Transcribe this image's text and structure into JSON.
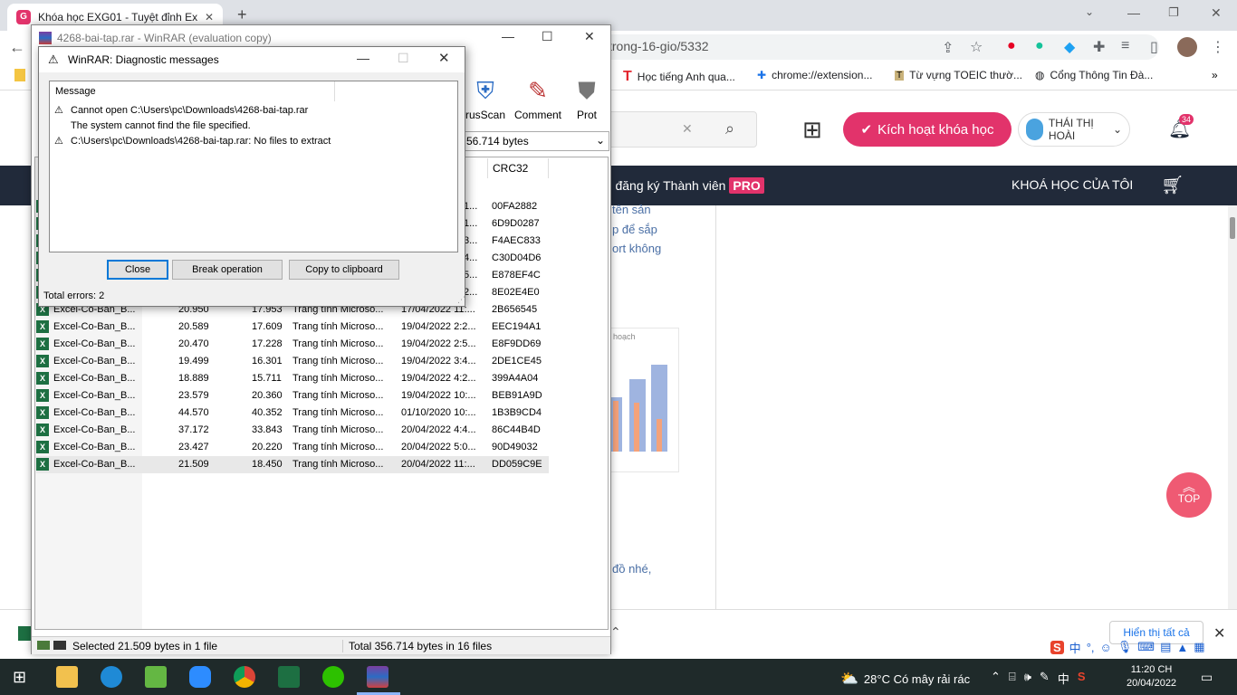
{
  "browser": {
    "tab_title": "Khóa học EXG01 - Tuyệt đỉnh Exc",
    "url_tail": "trong-16-gio/5332",
    "bookmarks": [
      "Học tiếng Anh qua...",
      "chrome://extension...",
      "Từ vựng TOEIC thườ...",
      "Cổng Thông Tin Đà..."
    ]
  },
  "site": {
    "activate_label": "Kích hoạt khóa học",
    "user_name": "THÁI THỊ HOÀI",
    "notif_count": "34",
    "nav_register": "ng đăng ký Thành viên",
    "nav_pro": "PRO",
    "nav_my_courses": "KHOÁ HỌC CỦA TÔI",
    "article_lines": [
      "tên sản",
      "p để sắp",
      "ort không"
    ],
    "article_bottom": "đồ nhé,",
    "chart_title": "hoạch",
    "top_label": "TOP",
    "show_all": "Hiển thị tất cả"
  },
  "winrar": {
    "title": "4268-bai-tap.rar - WinRAR (evaluation copy)",
    "tools": [
      "rusScan",
      "Comment",
      "Prot"
    ],
    "address_value": "56.714 bytes",
    "crc_header": "CRC32",
    "top_crcs": [
      "00FA2882",
      "6D9D0287",
      "F4AEC833",
      "C30D04D6",
      "E878EF4C",
      "8E02E4E0"
    ],
    "top_partial": [
      "1...",
      "1...",
      "3...",
      "4...",
      "5...",
      "2..."
    ],
    "rows": [
      {
        "name": "Excel-Co-Ban_B...",
        "size": "20.950",
        "packed": "17.953",
        "type": "Trang tính Microso...",
        "modified": "17/04/2022 11:...",
        "crc": "2B656545"
      },
      {
        "name": "Excel-Co-Ban_B...",
        "size": "20.589",
        "packed": "17.609",
        "type": "Trang tính Microso...",
        "modified": "19/04/2022 2:2...",
        "crc": "EEC194A1"
      },
      {
        "name": "Excel-Co-Ban_B...",
        "size": "20.470",
        "packed": "17.228",
        "type": "Trang tính Microso...",
        "modified": "19/04/2022 2:5...",
        "crc": "E8F9DD69"
      },
      {
        "name": "Excel-Co-Ban_B...",
        "size": "19.499",
        "packed": "16.301",
        "type": "Trang tính Microso...",
        "modified": "19/04/2022 3:4...",
        "crc": "2DE1CE45"
      },
      {
        "name": "Excel-Co-Ban_B...",
        "size": "18.889",
        "packed": "15.711",
        "type": "Trang tính Microso...",
        "modified": "19/04/2022 4:2...",
        "crc": "399A4A04"
      },
      {
        "name": "Excel-Co-Ban_B...",
        "size": "23.579",
        "packed": "20.360",
        "type": "Trang tính Microso...",
        "modified": "19/04/2022 10:...",
        "crc": "BEB91A9D"
      },
      {
        "name": "Excel-Co-Ban_B...",
        "size": "44.570",
        "packed": "40.352",
        "type": "Trang tính Microso...",
        "modified": "01/10/2020 10:...",
        "crc": "1B3B9CD4"
      },
      {
        "name": "Excel-Co-Ban_B...",
        "size": "37.172",
        "packed": "33.843",
        "type": "Trang tính Microso...",
        "modified": "20/04/2022 4:4...",
        "crc": "86C44B4D"
      },
      {
        "name": "Excel-Co-Ban_B...",
        "size": "23.427",
        "packed": "20.220",
        "type": "Trang tính Microso...",
        "modified": "20/04/2022 5:0...",
        "crc": "90D49032"
      },
      {
        "name": "Excel-Co-Ban_B...",
        "size": "21.509",
        "packed": "18.450",
        "type": "Trang tính Microso...",
        "modified": "20/04/2022 11:...",
        "crc": "DD059C9E"
      }
    ],
    "status_selected": "Selected 21.509 bytes in 1 file",
    "status_total": "Total 356.714 bytes in 16 files"
  },
  "dialog": {
    "title": "WinRAR: Diagnostic messages",
    "column_header": "Message",
    "messages": [
      "Cannot open C:\\Users\\pc\\Downloads\\4268-bai-tap.rar",
      "The system cannot find the file specified.",
      "C:\\Users\\pc\\Downloads\\4268-bai-tap.rar: No files to extract"
    ],
    "btn_close": "Close",
    "btn_break": "Break operation",
    "btn_copy": "Copy to clipboard",
    "total_errors": "Total errors: 2"
  },
  "taskbar": {
    "weather": "28°C  Có mây rải rác",
    "time": "11:20 CH",
    "date": "20/04/2022",
    "lang": "中"
  }
}
